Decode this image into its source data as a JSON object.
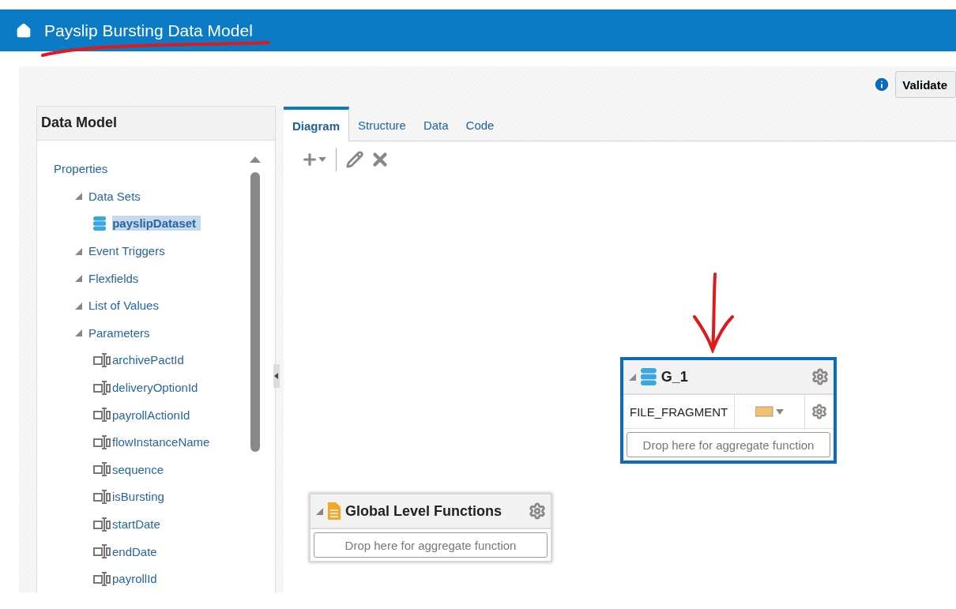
{
  "header": {
    "title": "Payslip Bursting Data Model"
  },
  "actions": {
    "validate": "Validate"
  },
  "data_model": {
    "title": "Data Model",
    "root": {
      "label": "Properties",
      "children": [
        {
          "label": "Data Sets",
          "expanded": true,
          "children": [
            {
              "label": "payslipDataset",
              "kind": "dataset",
              "selected": true
            }
          ]
        },
        {
          "label": "Event Triggers",
          "expanded": true
        },
        {
          "label": "Flexfields",
          "expanded": true
        },
        {
          "label": "List of Values",
          "expanded": true
        },
        {
          "label": "Parameters",
          "expanded": true,
          "children": [
            {
              "label": "archivePactId",
              "kind": "parameter",
              "selected": false
            },
            {
              "label": "deliveryOptionId",
              "kind": "parameter",
              "selected": false
            },
            {
              "label": "payrollActionId",
              "kind": "parameter",
              "selected": false
            },
            {
              "label": "flowInstanceName",
              "kind": "parameter",
              "selected": false
            },
            {
              "label": "sequence",
              "kind": "parameter",
              "selected": false
            },
            {
              "label": "isBursting",
              "kind": "parameter",
              "selected": false
            },
            {
              "label": "startDate",
              "kind": "parameter",
              "selected": false
            },
            {
              "label": "endDate",
              "kind": "parameter",
              "selected": false
            },
            {
              "label": "payrollId",
              "kind": "parameter",
              "selected": false
            }
          ]
        }
      ]
    }
  },
  "tabs": [
    {
      "label": "Diagram",
      "selected": true
    },
    {
      "label": "Structure",
      "selected": false
    },
    {
      "label": "Data",
      "selected": false
    },
    {
      "label": "Code",
      "selected": false
    }
  ],
  "nodes": [
    {
      "kind": "group",
      "title": "G_1",
      "expanded": true,
      "selected": true,
      "fields": [
        {
          "name": "FILE_FRAGMENT"
        }
      ],
      "drop_zone": "Drop here for aggregate function"
    },
    {
      "kind": "global",
      "title": "Global Level Functions",
      "expanded": true,
      "selected": false,
      "drop_zone": "Drop here for aggregate function"
    }
  ]
}
